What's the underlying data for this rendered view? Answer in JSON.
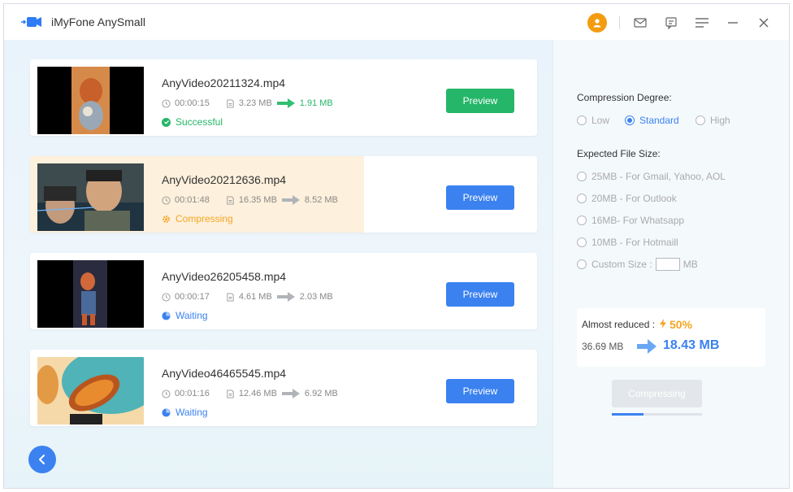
{
  "app": {
    "title": "iMyFone AnySmall"
  },
  "titlebar": {
    "icons": [
      "user-avatar-icon",
      "mail-icon",
      "feedback-icon",
      "menu-icon",
      "minimize-icon",
      "close-icon"
    ]
  },
  "colors": {
    "accent": "#3b82f0",
    "success": "#25b66a",
    "warning": "#f5a623"
  },
  "videos": [
    {
      "name": "AnyVideo20211324.mp4",
      "duration": "00:00:15",
      "size_before": "3.23 MB",
      "size_after": "1.91 MB",
      "status": "Successful",
      "status_type": "success",
      "preview_label": "Preview"
    },
    {
      "name": "AnyVideo20212636.mp4",
      "duration": "00:01:48",
      "size_before": "16.35 MB",
      "size_after": "8.52 MB",
      "status": "Compressing",
      "status_type": "compressing",
      "progress": 0.66,
      "preview_label": "Preview"
    },
    {
      "name": "AnyVideo26205458.mp4",
      "duration": "00:00:17",
      "size_before": "4.61 MB",
      "size_after": "2.03 MB",
      "status": "Waiting",
      "status_type": "waiting",
      "preview_label": "Preview"
    },
    {
      "name": "AnyVideo46465545.mp4",
      "duration": "00:01:16",
      "size_before": "12.46 MB",
      "size_after": "6.92 MB",
      "status": "Waiting",
      "status_type": "waiting",
      "preview_label": "Preview"
    }
  ],
  "sidebar": {
    "degree_label": "Compression Degree:",
    "degree_options": [
      "Low",
      "Standard",
      "High"
    ],
    "degree_selected": "Standard",
    "filesize_label": "Expected File Size:",
    "filesize_options": [
      "25MB - For Gmail, Yahoo, AOL",
      "20MB - For Outlook",
      "16MB- For Whatsapp",
      "10MB - For Hotmaill"
    ],
    "custom_label": "Custom Size :",
    "custom_unit": "MB",
    "almost_label": "Almost reduced :",
    "reduced_pct": "50%",
    "original_size": "36.69 MB",
    "new_size": "18.43 MB",
    "compress_button": "Compressing",
    "overall_progress": 0.35
  }
}
